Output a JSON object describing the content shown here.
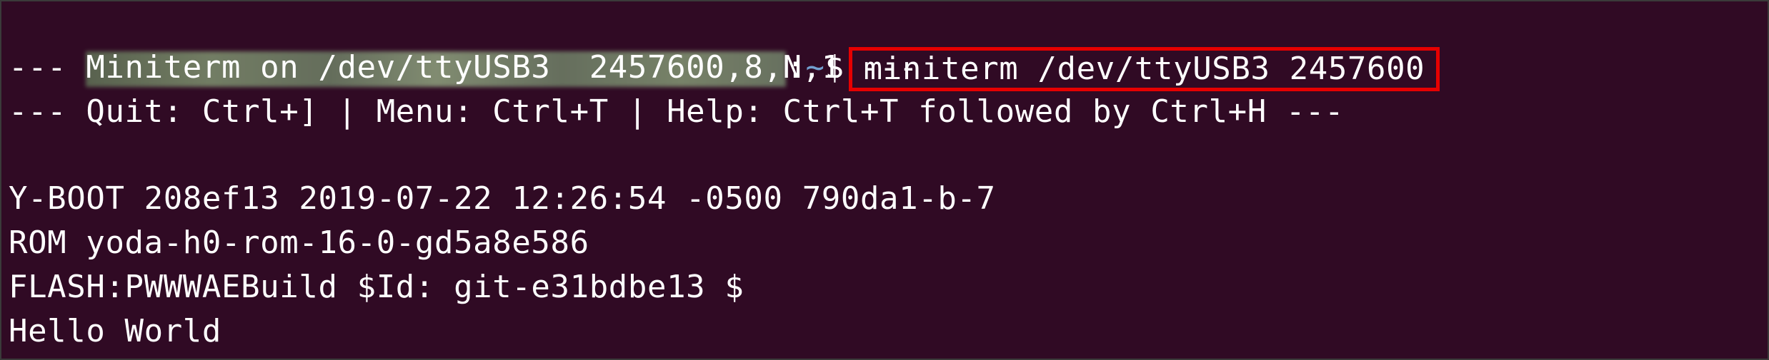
{
  "terminal": {
    "prompt": {
      "user_host": "",
      "separator": ":",
      "path": "~",
      "symbol": "$"
    },
    "command": "miniterm /dev/ttyUSB3 2457600",
    "output": [
      "--- Miniterm on /dev/ttyUSB3  2457600,8,N,1 ---",
      "--- Quit: Ctrl+] | Menu: Ctrl+T | Help: Ctrl+T followed by Ctrl+H ---",
      "Y-BOOT 208ef13 2019-07-22 12:26:54 -0500 790da1-b-7",
      "ROM yoda-h0-rom-16-0-gd5a8e586",
      "FLASH:PWWWAEBuild $Id: git-e31bdbe13 $",
      "Hello World"
    ],
    "colors": {
      "background": "#300a24",
      "text": "#ffffff",
      "path": "#729fcf",
      "highlight_box": "#e60000"
    }
  }
}
